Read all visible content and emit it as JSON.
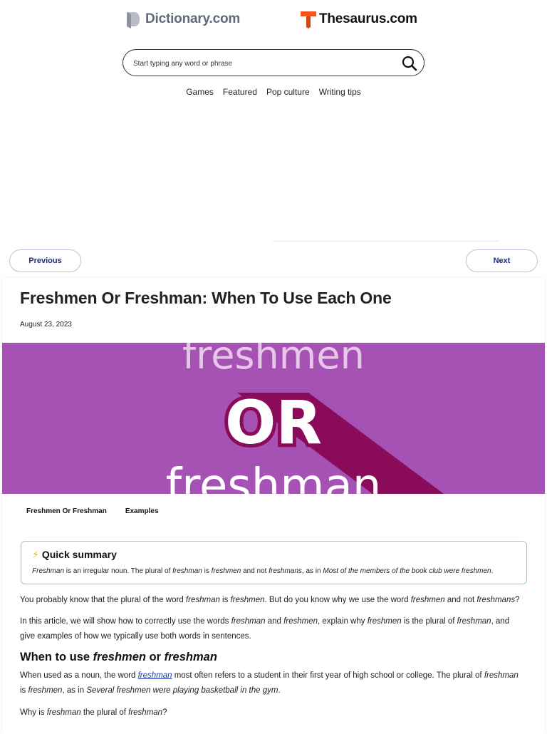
{
  "header": {
    "dictionary_brand": "Dictionary.com",
    "thesaurus_brand": "Thesaurus.com",
    "thesaurus_accent": "#f2561d",
    "dictionary_color": "#606a78"
  },
  "search": {
    "placeholder": "Start typing any word or phrase",
    "value": "",
    "icon": "search-icon"
  },
  "nav": {
    "items": [
      "Games",
      "Featured",
      "Pop culture",
      "Writing tips"
    ]
  },
  "pager": {
    "previous_label": "Previous",
    "next_label": "Next",
    "accent": "#1a2b7e"
  },
  "article": {
    "title": "Freshmen Or Freshman: When To Use Each One",
    "date": "August 23, 2023",
    "hero": {
      "background": "#a651b4",
      "shadow": "#8a0b5a",
      "words": [
        "freshmen",
        "OR",
        "freshman"
      ]
    },
    "toc": [
      "Freshmen Or Freshman",
      "Examples"
    ],
    "summary": {
      "icon": "⚡",
      "title": "Quick summary",
      "text_parts": [
        "Freshman",
        " is an irregular noun. The plural of ",
        "freshman",
        " is ",
        "freshmen",
        " and not ",
        "freshmans",
        ", as in ",
        "Most of the members of the book club were freshmen",
        "."
      ],
      "border_color": "#7fd0ee"
    },
    "p1_parts": [
      "You probably know that the plural of the word ",
      "freshman",
      " is ",
      "freshmen",
      ". But do you know why we use the word ",
      "freshmen",
      " and not ",
      "freshmans",
      "?"
    ],
    "p2_parts": [
      "In this article, we will show how to correctly use the words ",
      "freshman",
      " and ",
      "freshmen",
      ", explain why ",
      "freshmen",
      " is the plural of ",
      "freshman",
      ", and give examples of how we typically use both words in sentences."
    ],
    "h2_parts": [
      "When to use ",
      "freshmen",
      " or ",
      "freshman"
    ],
    "p3_parts": [
      "When used as a noun, the word ",
      "freshman",
      " most often refers to a student in their first year of high school or college. The plural of ",
      "freshman",
      " is ",
      "freshmen",
      ", as in ",
      "Several freshmen were playing basketball in the gym",
      "."
    ],
    "p4_parts": [
      "Why is ",
      "freshman",
      " the plural of ",
      "freshman",
      "?"
    ]
  }
}
